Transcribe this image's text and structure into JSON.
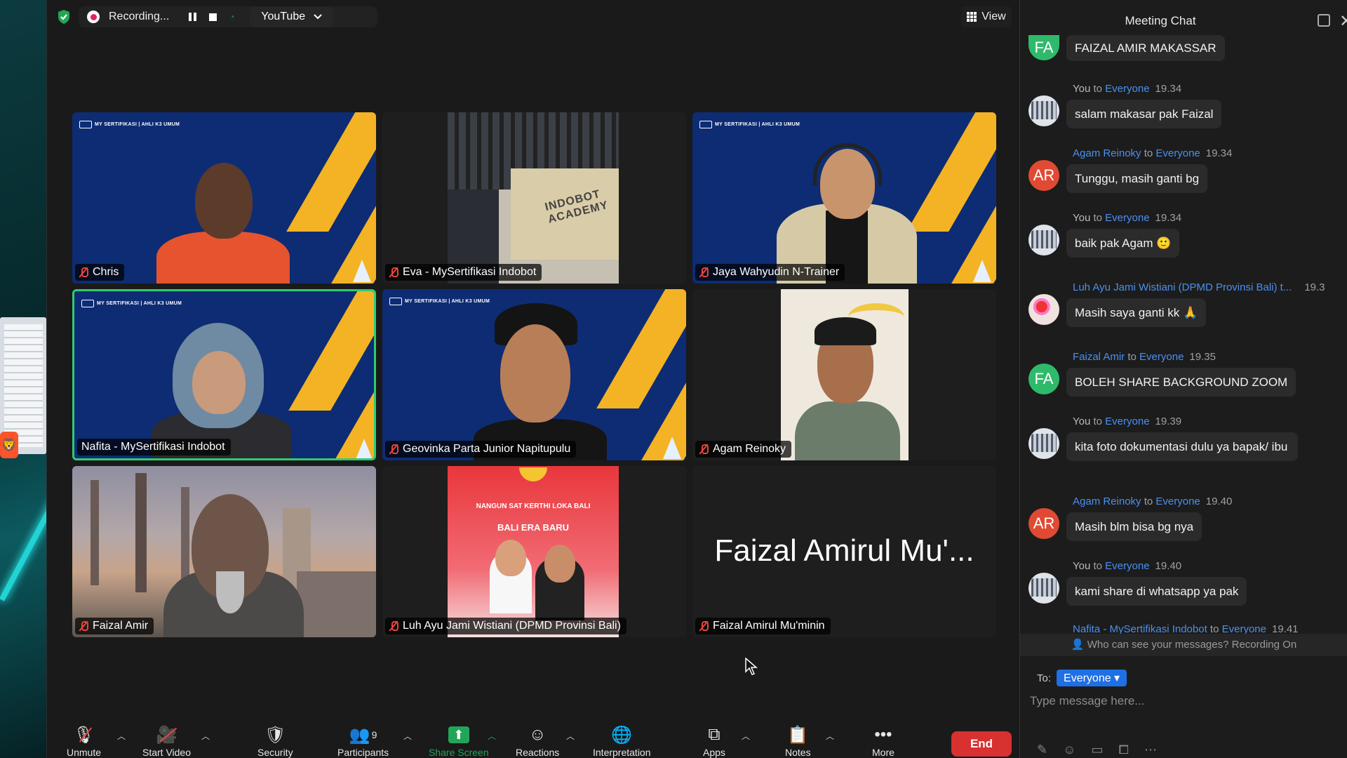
{
  "topbar": {
    "recording_label": "Recording...",
    "stream_target": "YouTube",
    "view_label": "View"
  },
  "tiles": [
    {
      "name": "Chris"
    },
    {
      "name": "Eva - MySertifikasi Indobot",
      "sign_line1": "INDOBOT",
      "sign_line2": "ACADEMY"
    },
    {
      "name": "Jaya Wahyudin N-Trainer"
    },
    {
      "name": "Nafita - MySertifikasi Indobot"
    },
    {
      "name": "Geovinka Parta Junior Napitupulu"
    },
    {
      "name": "Agam Reinoky"
    },
    {
      "name": "Faizal Amir"
    },
    {
      "name": "Luh Ayu Jami Wistiani (DPMD Provinsi Bali)",
      "poster_line1": "NANGUN SAT KERTHI LOKA BALI",
      "poster_line2": "BALI ERA BARU"
    },
    {
      "name": "Faizal Amirul Mu'minin",
      "display_name": "Faizal Amirul Mu'..."
    }
  ],
  "toolbar": {
    "unmute": "Unmute",
    "start_video": "Start Video",
    "security": "Security",
    "participants": "Participants",
    "participants_count": "9",
    "share_screen": "Share Screen",
    "reactions": "Reactions",
    "interpretation": "Interpretation",
    "apps": "Apps",
    "notes": "Notes",
    "more": "More",
    "end": "End"
  },
  "chat": {
    "title": "Meeting Chat",
    "messages": [
      {
        "avatar": "FA",
        "sender": "",
        "to": "",
        "time": "",
        "text": "FAIZAL AMIR MAKASSAR"
      },
      {
        "avatar": "",
        "sender": "You",
        "to": "Everyone",
        "time": "19.34",
        "text": "salam makasar pak Faizal"
      },
      {
        "avatar": "AR",
        "sender": "Agam Reinoky",
        "to": "Everyone",
        "time": "19.34",
        "text": "Tunggu, masih ganti bg"
      },
      {
        "avatar": "",
        "sender": "You",
        "to": "Everyone",
        "time": "19.34",
        "text": "baik pak Agam 🙂"
      },
      {
        "avatar": "",
        "sender": "Luh Ayu Jami Wistiani (DPMD Provinsi Bali) t...",
        "to": "",
        "time": "19.3",
        "text": "Masih saya ganti kk 🙏"
      },
      {
        "avatar": "FA",
        "sender": "Faizal Amir",
        "to": "Everyone",
        "time": "19.35",
        "text": "BOLEH SHARE BACKGROUND ZOOM"
      },
      {
        "avatar": "",
        "sender": "You",
        "to": "Everyone",
        "time": "19.39",
        "text": "kita foto dokumentasi dulu ya bapak/ ibu"
      },
      {
        "avatar": "AR",
        "sender": "Agam Reinoky",
        "to": "Everyone",
        "time": "19.40",
        "text": "Masih blm bisa bg nya"
      },
      {
        "avatar": "",
        "sender": "You",
        "to": "Everyone",
        "time": "19.40",
        "text": "kami share di whatsapp ya pak"
      },
      {
        "avatar": "",
        "sender": "Nafita - MySertifikasi Indobot",
        "to": "Everyone",
        "time": "19.41",
        "text": ""
      }
    ],
    "to_word": "to",
    "visibility_notice": "Who can see your messages? Recording On",
    "to_label": "To:",
    "recipient": "Everyone",
    "input_placeholder": "Type message here..."
  }
}
